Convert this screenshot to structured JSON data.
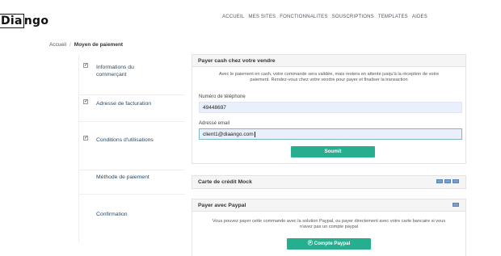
{
  "header": {
    "logo_boxed": "Dia",
    "logo_rest": "ngo",
    "nav": [
      "ACCUEIL",
      "MES SITES",
      "FONCTIONNALITES",
      "SOUSCRIPTIONS",
      "TEMPLATES",
      "AIDES"
    ]
  },
  "breadcrumb": {
    "home": "Accueil",
    "separator": "/",
    "current": "Moyen de paiement"
  },
  "steps": [
    {
      "label": "Informations du commerçant",
      "checked": true
    },
    {
      "label": "Adresse de facturation",
      "checked": true
    },
    {
      "label": "Conditions d'utilisations",
      "checked": true
    },
    {
      "label": "Méthode de paiement",
      "checked": false
    },
    {
      "label": "Confirmation",
      "checked": false
    }
  ],
  "cash": {
    "title": "Payer cash chez votre vendre",
    "intro": "Avec le paiement en cash, votre commande sera validée, mais restera en attente jusqu'à la réception de votre paiement. Rendez-vous chez votre vendre pour payer et finaliser la transaction",
    "phone_label": "Numéro de téléphone",
    "phone_value": "49448697",
    "email_label": "Adresse email",
    "email_value": "client1@diaango.com",
    "submit": "Soumit"
  },
  "card": {
    "title": "Carte de crédit Mock"
  },
  "paypal": {
    "title": "Payer avec Paypal",
    "intro": "Vous pouvez payer cette commande avec la solution Paypal, ou payer directement avec votre carte bancaire si vous n'avez pas un compte paypal",
    "button": "Compte Paypal",
    "button_icon": "paypal-icon"
  },
  "colors": {
    "accent": "#27ae8e",
    "step_text": "#2c4a63",
    "input_bg": "#eaf0fb"
  }
}
